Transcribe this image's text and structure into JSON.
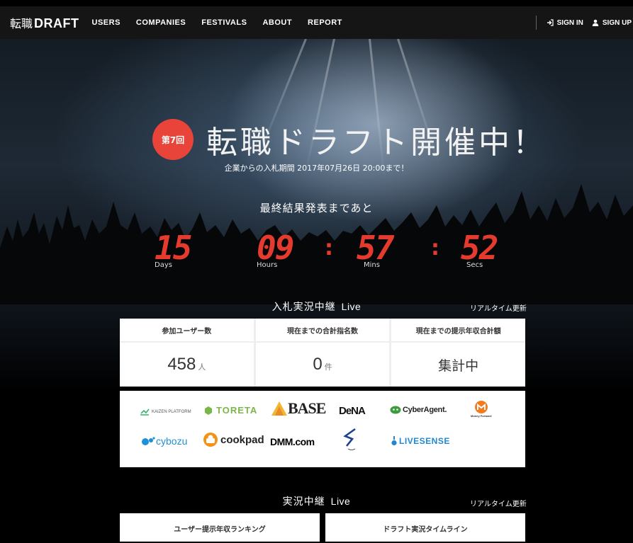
{
  "nav": {
    "brand_jp": "転職",
    "brand_en": "DRAFT",
    "links": [
      "USERS",
      "COMPANIES",
      "FESTIVALS",
      "ABOUT",
      "REPORT"
    ],
    "sign_in": "SIGN IN",
    "sign_up": "SIGN UP"
  },
  "hero": {
    "badge": "第7回",
    "title": "転職ドラフト開催中！",
    "subtitle": "企業からの入札期間 2017年07月26日 20:00まで！",
    "until": "最終結果発表まであと",
    "countdown": [
      {
        "value": "15",
        "unit": "Days"
      },
      {
        "value": "09",
        "unit": "Hours"
      },
      {
        "value": "57",
        "unit": "Mins"
      },
      {
        "value": "52",
        "unit": "Secs"
      }
    ]
  },
  "live1": {
    "title_jp": "入札実況中継",
    "title_en": "Live",
    "realtime": "リアルタイム更新",
    "stats": [
      {
        "label": "参加ユーザー数",
        "value": "458",
        "unit": "人"
      },
      {
        "label": "現在までの合計指名数",
        "value": "0",
        "unit": "件"
      },
      {
        "label": "現在までの提示年収合計額",
        "value": "集計中",
        "unit": ""
      }
    ]
  },
  "companies": {
    "kaizen": "KAIZEN PLATFORM",
    "toreta": "TORETA",
    "base": "BASE",
    "dena": "DeNA",
    "cyberagent": "CyberAgent.",
    "moneyforward": "Money Forward",
    "cybozu": "cybozu",
    "cookpad": "cookpad",
    "dmm": "DMM.com",
    "livesense": "LIVESENSE"
  },
  "live2": {
    "title_jp": "実況中継",
    "title_en": "Live",
    "realtime": "リアルタイム更新",
    "panels": [
      "ユーザー提示年収ランキング",
      "ドラフト実況タイムライン"
    ]
  },
  "colors": {
    "accent": "#e53a2e",
    "badge": "#e8443a",
    "nav_bg": "#151515"
  }
}
